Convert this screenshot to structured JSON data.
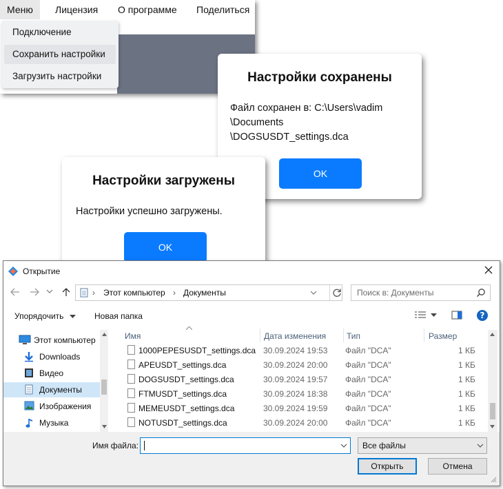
{
  "app": {
    "menubar": [
      "Меню",
      "Лицензия",
      "О программе",
      "Поделиться"
    ],
    "dropdown": [
      "Подключение",
      "Сохранить настройки",
      "Загрузить настройки"
    ]
  },
  "saved_dialog": {
    "title": "Настройки сохранены",
    "line1": "Файл сохранен в: C:\\Users\\vadim",
    "line2": "\\Documents",
    "line3": "\\DOGSUSDT_settings.dca",
    "ok": "OK"
  },
  "loaded_dialog": {
    "title": "Настройки загружены",
    "text": "Настройки успешно загружены.",
    "ok": "OK"
  },
  "open_dialog": {
    "title": "Открытие",
    "breadcrumb": [
      "Этот компьютер",
      "Документы"
    ],
    "search_placeholder": "Поиск в: Документы",
    "organize": "Упорядочить",
    "new_folder": "Новая папка",
    "nav": [
      "Этот компьютер",
      "Downloads",
      "Видео",
      "Документы",
      "Изображения",
      "Музыка"
    ],
    "columns": {
      "name": "Имя",
      "date": "Дата изменения",
      "type": "Тип",
      "size": "Размер"
    },
    "files": [
      {
        "name": "1000PEPESUSDT_settings.dca",
        "date": "30.09.2024 19:53",
        "type": "Файл \"DCA\"",
        "size": "1 КБ"
      },
      {
        "name": "APEUSDT_settings.dca",
        "date": "30.09.2024 20:00",
        "type": "Файл \"DCA\"",
        "size": "1 КБ"
      },
      {
        "name": "DOGSUSDT_settings.dca",
        "date": "30.09.2024 19:57",
        "type": "Файл \"DCA\"",
        "size": "1 КБ"
      },
      {
        "name": "FTMUSDT_settings.dca",
        "date": "30.09.2024 18:38",
        "type": "Файл \"DCA\"",
        "size": "1 КБ"
      },
      {
        "name": "MEMEUSDT_settings.dca",
        "date": "30.09.2024 19:59",
        "type": "Файл \"DCA\"",
        "size": "1 КБ"
      },
      {
        "name": "NOTUSDT_settings.dca",
        "date": "30.09.2024 20:00",
        "type": "Файл \"DCA\"",
        "size": "1 КБ"
      }
    ],
    "filename_label": "Имя файла:",
    "filename_value": "",
    "filter": "Все файлы",
    "open_button": "Открыть",
    "cancel_button": "Отмена"
  },
  "colors": {
    "accent": "#0a7bff",
    "app_gray": "#6b7282",
    "nav_selected": "#cfe6f8"
  }
}
